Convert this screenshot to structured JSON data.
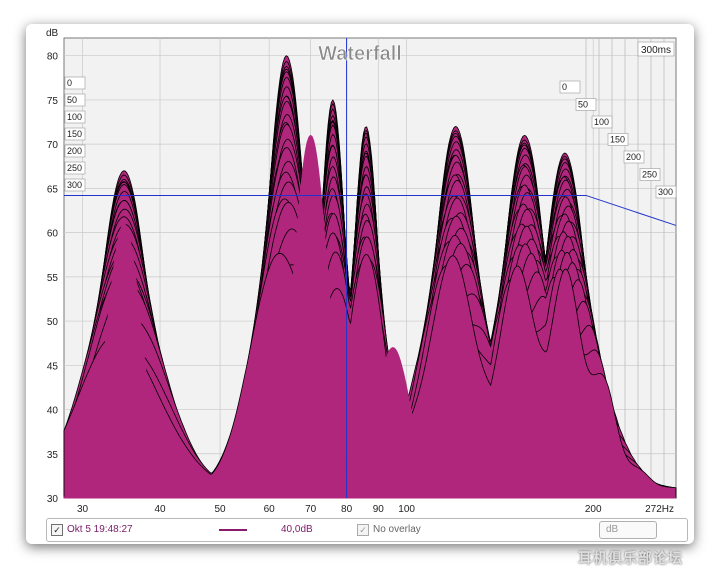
{
  "window": {
    "title": "Waterfall",
    "y_unit": "dB",
    "x_unit_suffix": "Hz",
    "time_max_label": "300ms"
  },
  "legend": {
    "measurement_name": "Okt 5 19:48:27",
    "measurement_checked": true,
    "measurement_color": "#8a1c6e",
    "level_label": "40,0dB",
    "overlay_label": "No overlay",
    "overlay_checked": true,
    "dropdown_value": "dB"
  },
  "watermark": "耳机俱乐部论坛",
  "chart_data": {
    "type": "area",
    "title": "Waterfall",
    "xlabel": "",
    "ylabel": "dB",
    "x_scale": "log",
    "xlim": [
      28,
      272
    ],
    "ylim": [
      30,
      82
    ],
    "x_ticks": [
      30,
      40,
      50,
      60,
      70,
      80,
      90,
      100,
      200
    ],
    "x_tick_labels": [
      "30",
      "40",
      "50",
      "60",
      "70",
      "80",
      "90",
      "100",
      "200",
      "272Hz"
    ],
    "y_ticks": [
      30,
      35,
      40,
      45,
      50,
      55,
      60,
      65,
      70,
      75,
      80
    ],
    "time_slices_ms": [
      0,
      50,
      100,
      150,
      200,
      250,
      300
    ],
    "reference_level_db": 64.2,
    "marker_frequency_hz": 80,
    "grid": true,
    "fill_color": "#b0267c",
    "edge_color": "#000000",
    "front_slice_peaks": [
      {
        "freq_hz": 35,
        "peak_db": 61
      },
      {
        "freq_hz": 70,
        "peak_db": 71
      },
      {
        "freq_hz": 95,
        "peak_db": 47
      },
      {
        "freq_hz": 125,
        "peak_db": 49
      },
      {
        "freq_hz": 150,
        "peak_db": 50
      }
    ],
    "max_envelope_peaks": [
      {
        "freq_hz": 35,
        "peak_db": 67
      },
      {
        "freq_hz": 64,
        "peak_db": 80
      },
      {
        "freq_hz": 76,
        "peak_db": 75
      },
      {
        "freq_hz": 86,
        "peak_db": 72
      },
      {
        "freq_hz": 120,
        "peak_db": 72
      },
      {
        "freq_hz": 155,
        "peak_db": 71
      },
      {
        "freq_hz": 180,
        "peak_db": 69
      }
    ]
  }
}
